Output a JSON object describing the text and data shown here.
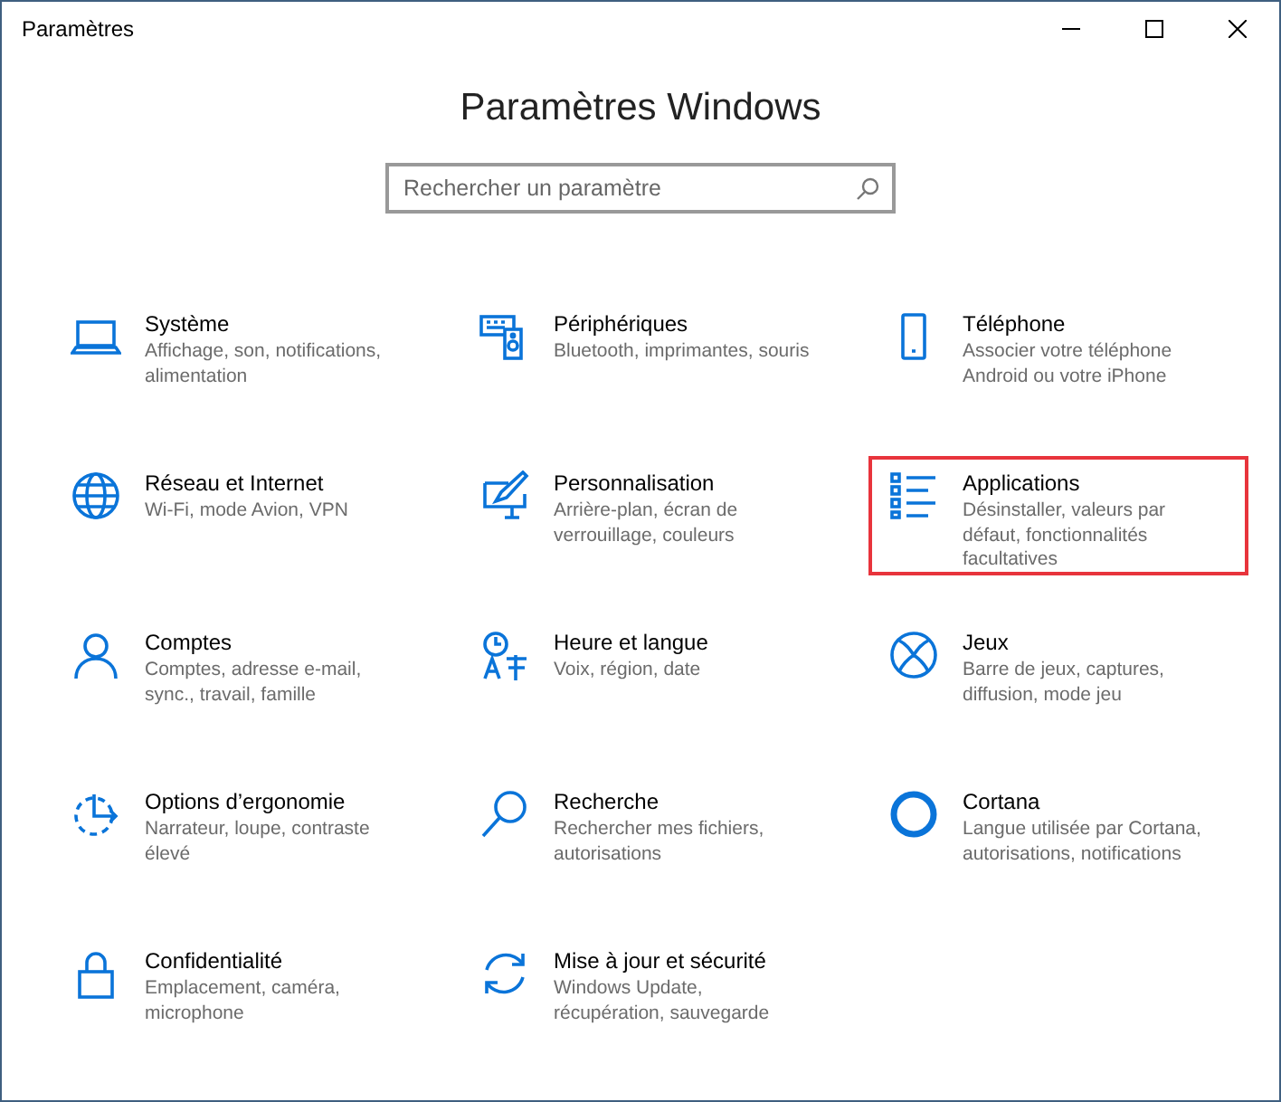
{
  "window": {
    "title": "Paramètres"
  },
  "heading": "Paramètres Windows",
  "search": {
    "placeholder": "Rechercher un paramètre"
  },
  "categories": [
    {
      "title": "Système",
      "description": "Affichage, son, notifications, alimentation",
      "highlighted": false
    },
    {
      "title": "Périphériques",
      "description": "Bluetooth, imprimantes, souris",
      "highlighted": false
    },
    {
      "title": "Téléphone",
      "description": "Associer votre téléphone Android ou votre iPhone",
      "highlighted": false
    },
    {
      "title": "Réseau et Internet",
      "description": "Wi-Fi, mode Avion, VPN",
      "highlighted": false
    },
    {
      "title": "Personnalisation",
      "description": "Arrière-plan, écran de verrouillage, couleurs",
      "highlighted": false
    },
    {
      "title": "Applications",
      "description": "Désinstaller, valeurs par défaut, fonctionnalités facultatives",
      "highlighted": true
    },
    {
      "title": "Comptes",
      "description": "Comptes, adresse e-mail, sync., travail, famille",
      "highlighted": false
    },
    {
      "title": "Heure et langue",
      "description": "Voix, région, date",
      "highlighted": false
    },
    {
      "title": "Jeux",
      "description": "Barre de jeux, captures, diffusion, mode jeu",
      "highlighted": false
    },
    {
      "title": "Options d’ergonomie",
      "description": "Narrateur, loupe, contraste élevé",
      "highlighted": false
    },
    {
      "title": "Recherche",
      "description": "Rechercher mes fichiers, autorisations",
      "highlighted": false
    },
    {
      "title": "Cortana",
      "description": "Langue utilisée par Cortana, autorisations, notifications",
      "highlighted": false
    },
    {
      "title": "Confidentialité",
      "description": "Emplacement, caméra, microphone",
      "highlighted": false
    },
    {
      "title": "Mise à jour et sécurité",
      "description": "Windows Update, récupération, sauvegarde",
      "highlighted": false
    }
  ]
}
